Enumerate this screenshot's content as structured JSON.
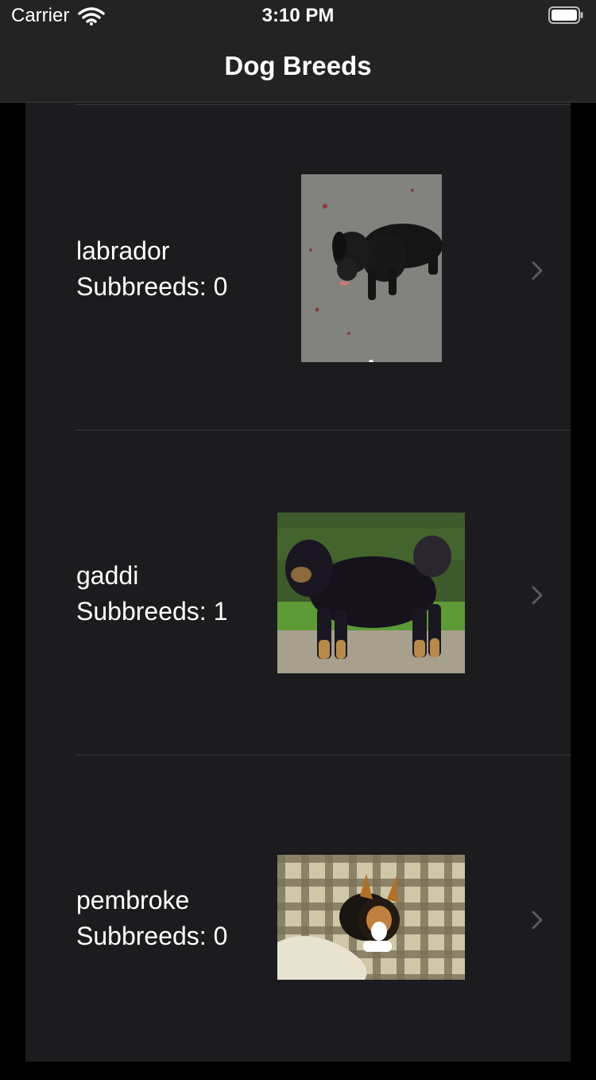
{
  "status_bar": {
    "carrier": "Carrier",
    "time": "3:10 PM"
  },
  "nav": {
    "title": "Dog Breeds"
  },
  "breeds": [
    {
      "name": "labrador",
      "subbreeds": "Subbreeds: 0",
      "photo": "black-labrador-photo"
    },
    {
      "name": "gaddi",
      "subbreeds": "Subbreeds: 1",
      "photo": "black-and-tan-mastiff-photo"
    },
    {
      "name": "pembroke",
      "subbreeds": "Subbreeds: 0",
      "photo": "corgi-on-plaid-blanket-photo"
    }
  ],
  "colors": {
    "background": "#000000",
    "cell": "#1c1c1e",
    "bar": "#232323",
    "separator": "#3a3a3c",
    "chevron": "#5a5a5e"
  }
}
